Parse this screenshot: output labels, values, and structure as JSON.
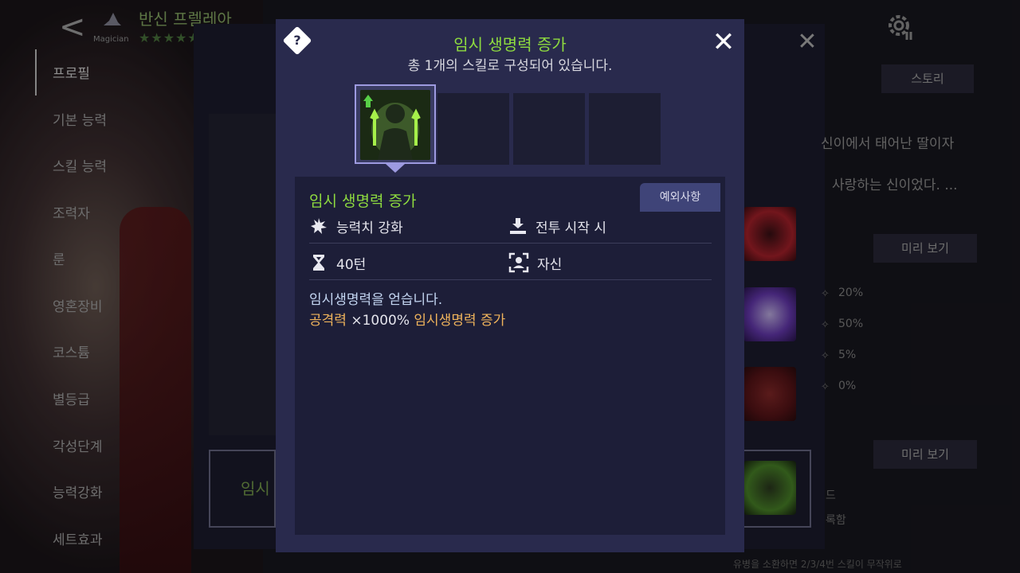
{
  "header": {
    "back_label": "<",
    "char_class": "Magician",
    "char_name": "반신 프렐레아",
    "stars": "★★★★★"
  },
  "nav": {
    "items": [
      {
        "label": "프로필",
        "active": true
      },
      {
        "label": "기본 능력"
      },
      {
        "label": "스킬 능력"
      },
      {
        "label": "조력자"
      },
      {
        "label": "룬"
      },
      {
        "label": "영혼장비"
      },
      {
        "label": "코스튬"
      },
      {
        "label": "별등급"
      },
      {
        "label": "각성단계"
      },
      {
        "label": "능력강화"
      },
      {
        "label": "세트효과"
      }
    ]
  },
  "right_panel": {
    "story_button": "스토리",
    "story_lines": [
      "신이에서 태어난 딸이자",
      "사랑하는 신이었다. ..."
    ],
    "preview_button_1": "미리 보기",
    "preview_button_2": "미리 보기",
    "stat_pcts": [
      "20%",
      "50%",
      "5%",
      "0%"
    ],
    "under_selected_text": "임시",
    "small_1": "드",
    "small_2": "록함",
    "bottom_faded": "유병을 소환하면 2/3/4번 스킬이 무작위로"
  },
  "modal": {
    "help_symbol": "?",
    "title": "임시 생명력 증가",
    "subtitle": "총 1개의 스킬로 구성되어 있습니다.",
    "close_symbol": "✕",
    "detail": {
      "skill_name": "임시 생명력 증가",
      "exception_tab": "예외사항",
      "type_label": "능력치 강화",
      "timing_label": "전투 시작 시",
      "duration_label": "40턴",
      "target_label": "자신",
      "desc_line1": "임시생명력을 얻습니다.",
      "desc_stat": "공격력",
      "desc_mult": "×1000%",
      "desc_effect": "임시생명력 증가"
    }
  },
  "colors": {
    "modal_bg": "#292a4d",
    "accent_green": "#8edb3f",
    "accent_orange": "#f0b45c"
  }
}
